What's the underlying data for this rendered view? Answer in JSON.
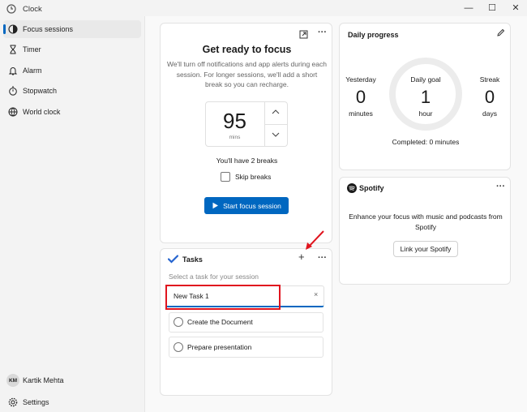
{
  "window": {
    "title": "Clock"
  },
  "sidebar": {
    "items": [
      {
        "label": "Focus sessions",
        "icon": "focus-icon"
      },
      {
        "label": "Timer",
        "icon": "hourglass-icon"
      },
      {
        "label": "Alarm",
        "icon": "alarm-icon"
      },
      {
        "label": "Stopwatch",
        "icon": "stopwatch-icon"
      },
      {
        "label": "World clock",
        "icon": "globe-icon"
      }
    ],
    "user": {
      "initials": "KM",
      "name": "Kartik Mehta"
    },
    "settings_label": "Settings"
  },
  "focus": {
    "title": "Get ready to focus",
    "description": "We'll turn off notifications and app alerts during each session. For longer sessions, we'll add a short break so you can recharge.",
    "minutes_value": "95",
    "minutes_unit": "mins",
    "breaks_text": "You'll have 2 breaks",
    "skip_breaks_label": "Skip breaks",
    "start_button": "Start focus session"
  },
  "tasks": {
    "title": "Tasks",
    "subtitle": "Select a task for your session",
    "new_task_value": "New Task 1",
    "items": [
      "Create the Document",
      "Prepare presentation"
    ]
  },
  "daily_progress": {
    "title": "Daily progress",
    "yesterday_label": "Yesterday",
    "yesterday_value": "0",
    "yesterday_unit": "minutes",
    "goal_label": "Daily goal",
    "goal_value": "1",
    "goal_unit": "hour",
    "streak_label": "Streak",
    "streak_value": "0",
    "streak_unit": "days",
    "completed_text": "Completed: 0 minutes"
  },
  "spotify": {
    "brand": "Spotify",
    "description": "Enhance your focus with music and podcasts from Spotify",
    "link_button": "Link your Spotify"
  },
  "colors": {
    "accent": "#0067c0",
    "highlight": "#e0141e",
    "spotify": "#1a1a1a"
  }
}
